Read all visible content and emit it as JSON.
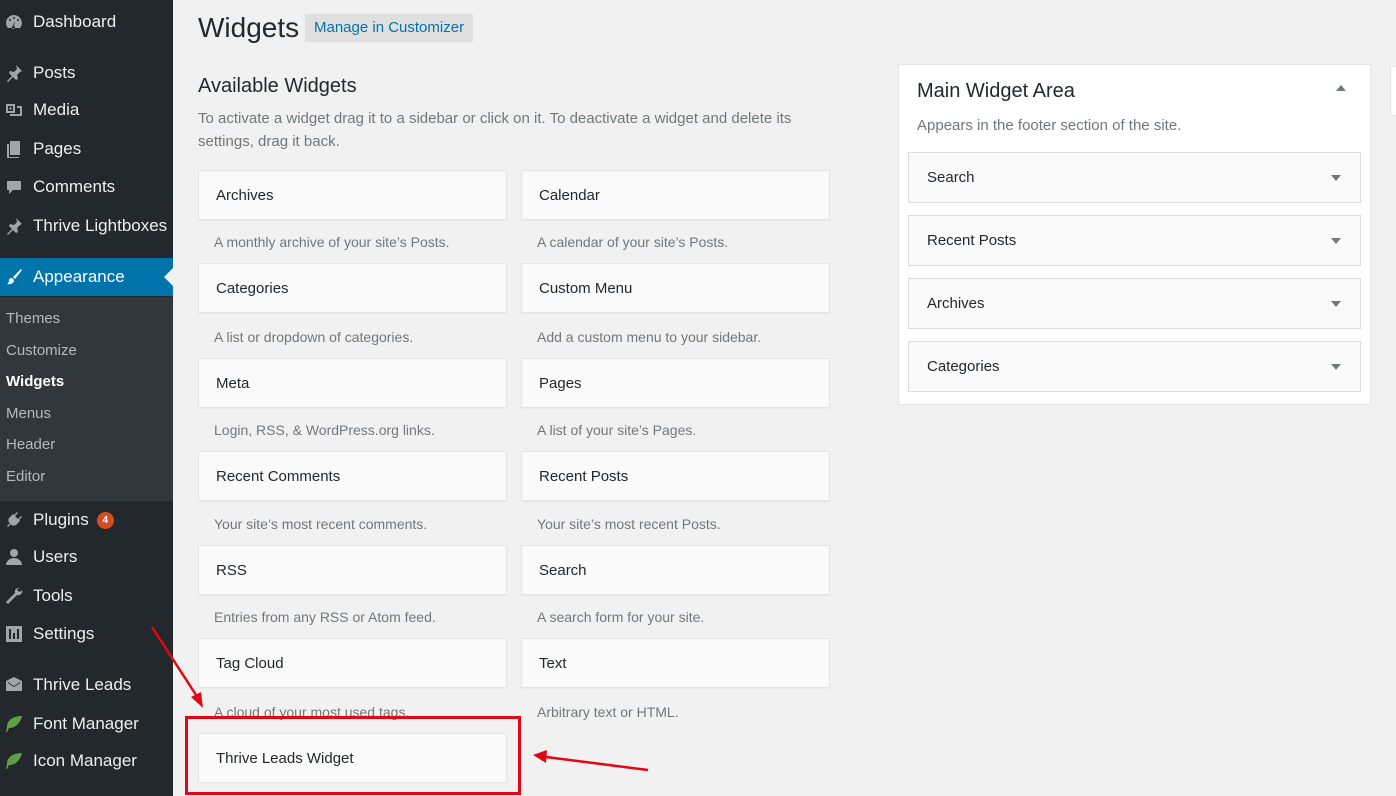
{
  "sidebar": {
    "items": [
      {
        "label": "Dashboard",
        "icon": "dashboard-icon",
        "badge": ""
      },
      {
        "label": "Posts",
        "icon": "pin-icon",
        "badge": ""
      },
      {
        "label": "Media",
        "icon": "media-icon",
        "badge": ""
      },
      {
        "label": "Pages",
        "icon": "pages-icon",
        "badge": ""
      },
      {
        "label": "Comments",
        "icon": "comment-icon",
        "badge": ""
      },
      {
        "label": "Thrive Lightboxes",
        "icon": "pin-icon",
        "badge": ""
      },
      {
        "label": "Appearance",
        "icon": "paintbrush-icon",
        "badge": ""
      },
      {
        "label": "Plugins",
        "icon": "plugin-icon",
        "badge": "4"
      },
      {
        "label": "Users",
        "icon": "user-icon",
        "badge": ""
      },
      {
        "label": "Tools",
        "icon": "wrench-icon",
        "badge": ""
      },
      {
        "label": "Settings",
        "icon": "settings-icon",
        "badge": ""
      },
      {
        "label": "Thrive Leads",
        "icon": "envelope-icon",
        "badge": ""
      },
      {
        "label": "Font Manager",
        "icon": "leaf-icon",
        "badge": ""
      },
      {
        "label": "Icon Manager",
        "icon": "leaf-icon",
        "badge": ""
      }
    ],
    "submenu": [
      "Themes",
      "Customize",
      "Widgets",
      "Menus",
      "Header",
      "Editor"
    ]
  },
  "header": {
    "title": "Widgets",
    "manage_label": "Manage in Customizer"
  },
  "available": {
    "title": "Available Widgets",
    "description": "To activate a widget drag it to a sidebar or click on it. To deactivate a widget and delete its settings, drag it back.",
    "widgets": [
      {
        "name": "Archives",
        "desc": "A monthly archive of your site’s Posts."
      },
      {
        "name": "Calendar",
        "desc": "A calendar of your site’s Posts."
      },
      {
        "name": "Categories",
        "desc": "A list or dropdown of categories."
      },
      {
        "name": "Custom Menu",
        "desc": "Add a custom menu to your sidebar."
      },
      {
        "name": "Meta",
        "desc": "Login, RSS, & WordPress.org links."
      },
      {
        "name": "Pages",
        "desc": "A list of your site’s Pages."
      },
      {
        "name": "Recent Comments",
        "desc": "Your site’s most recent comments."
      },
      {
        "name": "Recent Posts",
        "desc": "Your site’s most recent Posts."
      },
      {
        "name": "RSS",
        "desc": "Entries from any RSS or Atom feed."
      },
      {
        "name": "Search",
        "desc": "A search form for your site."
      },
      {
        "name": "Tag Cloud",
        "desc": "A cloud of your most used tags."
      },
      {
        "name": "Text",
        "desc": "Arbitrary text or HTML."
      },
      {
        "name": "Thrive Leads Widget",
        "desc": ""
      }
    ]
  },
  "main_area": {
    "title": "Main Widget Area",
    "description": "Appears in the footer section of the site.",
    "widgets": [
      "Search",
      "Recent Posts",
      "Archives",
      "Categories"
    ]
  },
  "colors": {
    "sidebar_bg": "#23282d",
    "active_bg": "#0073aa",
    "annotation": "#e30613"
  }
}
